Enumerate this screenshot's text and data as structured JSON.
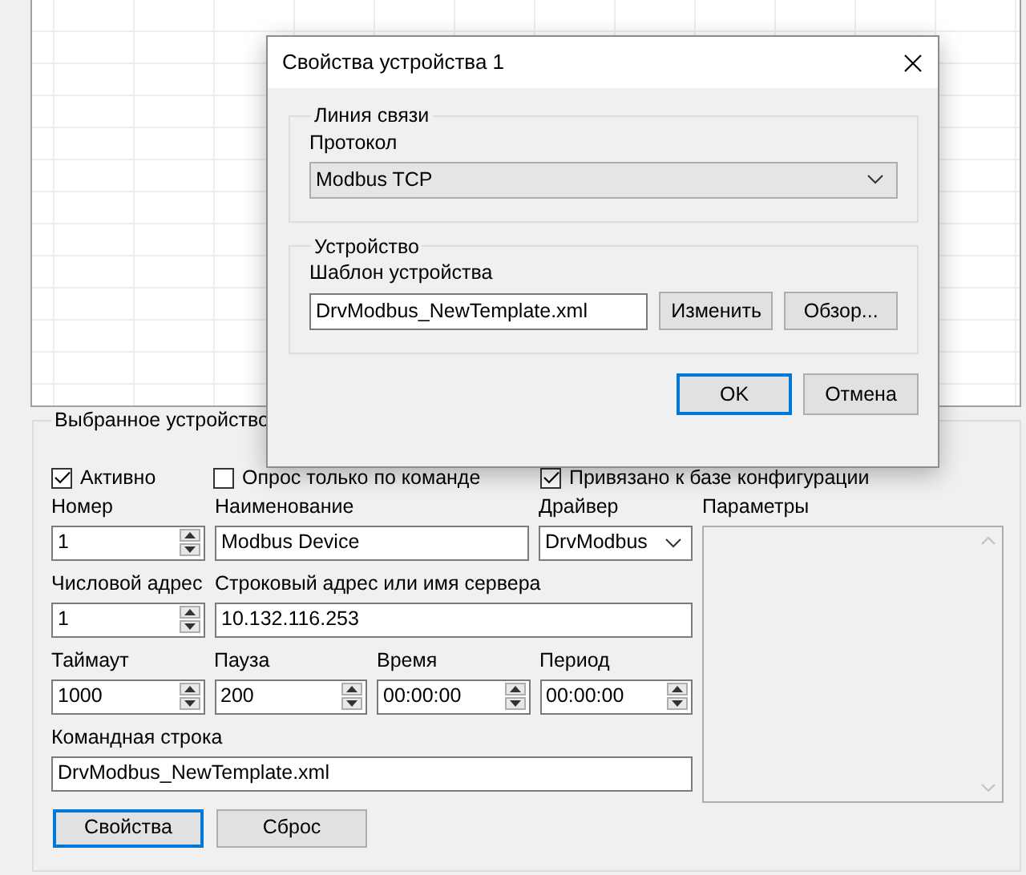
{
  "main": {
    "group_title": "Выбранное устройство",
    "checkboxes": [
      {
        "label": "Активно",
        "checked": true
      },
      {
        "label": "Опрос только по команде",
        "checked": false
      },
      {
        "label": "Привязано к базе конфигурации",
        "checked": true
      }
    ],
    "field_rows": [
      [
        {
          "kind": "spin",
          "label": "Номер",
          "value": "1"
        },
        {
          "kind": "text",
          "label": "Наименование",
          "value": "Modbus Device"
        },
        {
          "kind": "select",
          "label": "Драйвер",
          "value": "DrvModbus"
        }
      ],
      [
        {
          "kind": "spin",
          "label": "Числовой адрес",
          "value": "1"
        },
        {
          "kind": "text",
          "label": "Строковый адрес или имя сервера",
          "value": "10.132.116.253"
        }
      ],
      [
        {
          "kind": "spin",
          "label": "Таймаут",
          "value": "1000"
        },
        {
          "kind": "spin",
          "label": "Пауза",
          "value": "200"
        },
        {
          "kind": "spin",
          "label": "Время",
          "value": "00:00:00"
        },
        {
          "kind": "spin",
          "label": "Период",
          "value": "00:00:00"
        }
      ],
      [
        {
          "kind": "text",
          "label": "Командная строка",
          "value": "DrvModbus_NewTemplate.xml"
        }
      ]
    ],
    "parameters_label": "Параметры",
    "buttons": [
      {
        "label": "Свойства",
        "focused": true
      },
      {
        "label": "Сброс",
        "focused": false
      }
    ]
  },
  "dialog": {
    "title": "Свойства устройства 1",
    "link_group": {
      "title": "Линия связи",
      "protocol_label": "Протокол",
      "protocol": "Modbus TCP"
    },
    "device_group": {
      "title": "Устройство",
      "template_label": "Шаблон устройства",
      "template": "DrvModbus_NewTemplate.xml",
      "buttons": [
        "Изменить",
        "Обзор..."
      ]
    },
    "buttons": [
      {
        "label": "OK",
        "focused": true
      },
      {
        "label": "Отмена",
        "focused": false
      }
    ]
  }
}
